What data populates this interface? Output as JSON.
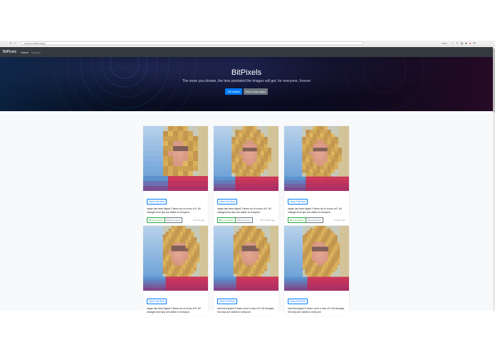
{
  "browser": {
    "url": "localhost:3000/images",
    "zoom": "100%",
    "back_icon": "arrow-left",
    "forward_icon": "arrow-right",
    "reload_icon": "reload",
    "home_icon": "home"
  },
  "navbar": {
    "brand": "BitPixels",
    "links": [
      {
        "label": "Home",
        "active": true
      },
      {
        "label": "Images",
        "active": false
      }
    ]
  },
  "hero": {
    "title": "BitPixels",
    "subtitle": "The more you donate, the less pixelated the images will get, for everyone, forever",
    "primary_button": "Get started",
    "secondary_button": "How to use crypto"
  },
  "cards": [
    {
      "view_label": "View Full Size",
      "description": "vegas has been tipped 3 times out of a max of 9. All changes from tips are visible to everyone.",
      "tip_label": "$8 (one upper)",
      "full_label": "$42 (full clear)",
      "time": "8 hours ago",
      "pixel_level": 0.25
    },
    {
      "view_label": "View Full Size",
      "description": "vegas has been tipped 3 times out of a max of 9. All changes from tips are visible to everyone.",
      "tip_label": "$8 (one upper)",
      "full_label": "$42 (full clear)",
      "time": "48 minutes ago",
      "pixel_level": 0.5
    },
    {
      "view_label": "View Full Size",
      "description": "vegas has been tipped 3 times out of a max of 9. All changes from tips are visible to everyone.",
      "tip_label": "$8 (one upper)",
      "full_label": "$42 (full clear)",
      "time": "2 hours ago",
      "pixel_level": 0.5
    },
    {
      "view_label": "View Full Size",
      "description": "vegas has been tipped 3 times out of a max of 9. All changes from tips are visible to everyone.",
      "pixel_level": 0.75
    },
    {
      "view_label": "View Full Size",
      "description": "has been tipped 3 times out of a max of 9. All changes from tips are visible to everyone.",
      "pixel_level": 0.75
    },
    {
      "view_label": "View Full Size",
      "description": "has been tipped 3 times out of a max of 9. All changes from tips are visible to everyone.",
      "pixel_level": 1.0
    }
  ]
}
